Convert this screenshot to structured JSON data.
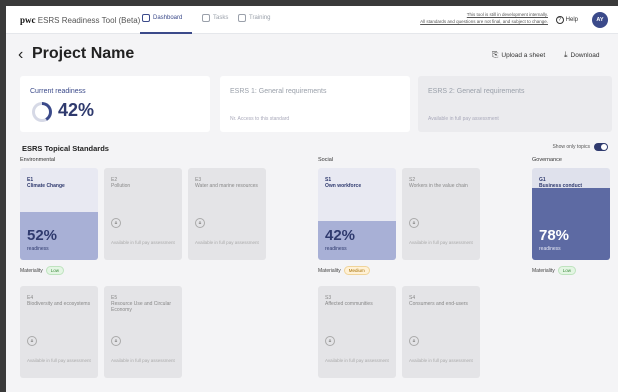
{
  "topbar": {
    "brand_name": "pwc",
    "brand_sub": "ESRS Readiness Tool (Beta)",
    "tabs": [
      {
        "label": "Dashboard",
        "active": true
      },
      {
        "label": "Tasks",
        "active": false
      },
      {
        "label": "Training",
        "active": false
      }
    ],
    "notice_line1": "This tool is still in development internally.",
    "notice_line2": "All standards and questions are not final, and subject to change.",
    "help_label": "Help",
    "avatar_initials": "AY"
  },
  "header": {
    "back_icon": "chevron-left-icon",
    "title": "Project Name",
    "upload_label": "Upload a sheet",
    "download_label": "Download"
  },
  "summary": {
    "readiness_label": "Current readiness",
    "readiness_value": "42%",
    "readiness_fraction": 0.42,
    "esrs1_label": "ESRS 1: General requirements",
    "esrs1_sub": "Nr. Access to this standard",
    "esrs2_label": "ESRS 2: General requirements",
    "esrs2_sub": "Available in full pay assessment"
  },
  "standards": {
    "section_title": "ESRS Topical Standards",
    "toggle_label": "Show only topics",
    "groups": [
      "Environmental",
      "Social",
      "Governance"
    ],
    "tiles": [
      {
        "code": "E1",
        "name": "Climate Change",
        "value": "52%",
        "readiness_label": "readiness",
        "fill": 0.52
      },
      {
        "code": "E2",
        "name": "Pollution",
        "avail": "Available in full pay assessment"
      },
      {
        "code": "E3",
        "name": "Water and marine resources",
        "avail": "Available in full pay assessment"
      },
      {
        "code": "E4",
        "name": "Biodiversity and ecosystems",
        "avail": "Available in full pay assessment"
      },
      {
        "code": "E5",
        "name": "Resource Use and Circular Economy",
        "avail": "Available in full pay assessment"
      },
      {
        "code": "S1",
        "name": "Own workforce",
        "value": "42%",
        "readiness_label": "readiness",
        "fill": 0.42
      },
      {
        "code": "S2",
        "name": "Workers in the value chain",
        "avail": "Available in full pay assessment"
      },
      {
        "code": "S3",
        "name": "Affected communities",
        "avail": "Available in full pay assessment"
      },
      {
        "code": "S4",
        "name": "Consumers and end-users",
        "avail": "Available in full pay assessment"
      },
      {
        "code": "G1",
        "name": "Business conduct",
        "value": "78%",
        "readiness_label": "readiness",
        "fill": 0.78
      }
    ],
    "status": [
      {
        "label": "Materiality",
        "badge": "Low"
      },
      {
        "label": "Materiality",
        "badge": "Medium"
      },
      {
        "label": "Materiality",
        "badge": "Low"
      }
    ]
  }
}
